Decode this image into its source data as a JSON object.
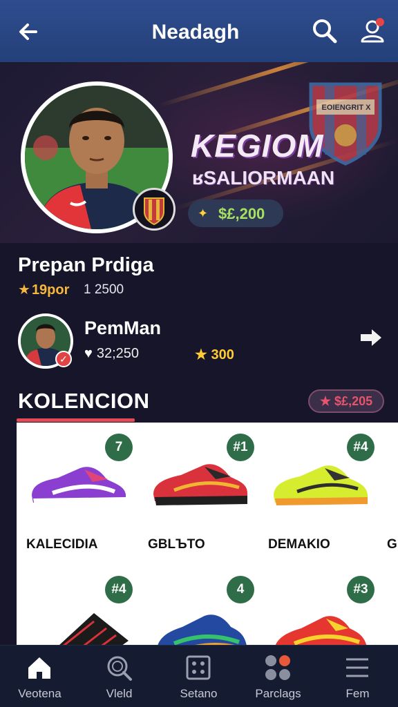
{
  "header": {
    "title": "Neadagh",
    "icons": [
      "back-arrow-icon",
      "search-icon",
      "user-icon"
    ],
    "notification_color": "#e64545"
  },
  "hero": {
    "title": "KEGIOM",
    "subtitle": "ʁSALIORMAAN",
    "crest_text": "EOIENGRIT X",
    "coins": "$£,200"
  },
  "player": {
    "name": "Prepan Prdiga",
    "rating": "19por",
    "meta": "1  2500"
  },
  "friend": {
    "name": "PemMan",
    "likes": "32;250",
    "score": "300"
  },
  "collection": {
    "title": "KOLENCION",
    "pill": "$£,205",
    "accent": "#e74a52",
    "items": [
      {
        "badge": "7",
        "label": "KALECIDIA"
      },
      {
        "badge": "#1",
        "label": "GBLЪTO"
      },
      {
        "badge": "#4",
        "label": "DEMAKIO"
      },
      {
        "badge": "",
        "label": "GI"
      },
      {
        "badge": "#4",
        "label": ""
      },
      {
        "badge": "4",
        "label": ""
      },
      {
        "badge": "#3",
        "label": ""
      }
    ]
  },
  "bottom_nav": [
    {
      "label": "Veotena",
      "icon": "home-icon"
    },
    {
      "label": "Vleld",
      "icon": "search-icon"
    },
    {
      "label": "Setano",
      "icon": "dice-icon"
    },
    {
      "label": "Parclags",
      "icon": "apps-icon"
    },
    {
      "label": "Fem",
      "icon": "menu-icon"
    }
  ]
}
